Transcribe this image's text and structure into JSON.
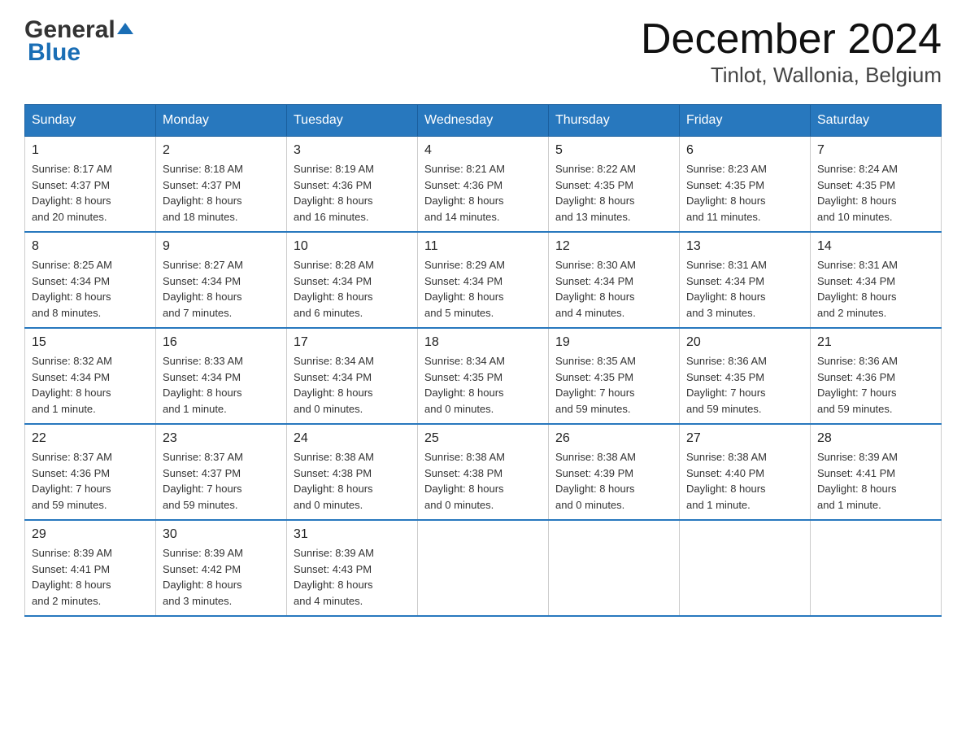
{
  "header": {
    "logo_general": "General",
    "logo_blue": "Blue",
    "month_title": "December 2024",
    "location": "Tinlot, Wallonia, Belgium"
  },
  "weekdays": [
    "Sunday",
    "Monday",
    "Tuesday",
    "Wednesday",
    "Thursday",
    "Friday",
    "Saturday"
  ],
  "weeks": [
    [
      {
        "day": "1",
        "sunrise": "8:17 AM",
        "sunset": "4:37 PM",
        "daylight": "8 hours and 20 minutes."
      },
      {
        "day": "2",
        "sunrise": "8:18 AM",
        "sunset": "4:37 PM",
        "daylight": "8 hours and 18 minutes."
      },
      {
        "day": "3",
        "sunrise": "8:19 AM",
        "sunset": "4:36 PM",
        "daylight": "8 hours and 16 minutes."
      },
      {
        "day": "4",
        "sunrise": "8:21 AM",
        "sunset": "4:36 PM",
        "daylight": "8 hours and 14 minutes."
      },
      {
        "day": "5",
        "sunrise": "8:22 AM",
        "sunset": "4:35 PM",
        "daylight": "8 hours and 13 minutes."
      },
      {
        "day": "6",
        "sunrise": "8:23 AM",
        "sunset": "4:35 PM",
        "daylight": "8 hours and 11 minutes."
      },
      {
        "day": "7",
        "sunrise": "8:24 AM",
        "sunset": "4:35 PM",
        "daylight": "8 hours and 10 minutes."
      }
    ],
    [
      {
        "day": "8",
        "sunrise": "8:25 AM",
        "sunset": "4:34 PM",
        "daylight": "8 hours and 8 minutes."
      },
      {
        "day": "9",
        "sunrise": "8:27 AM",
        "sunset": "4:34 PM",
        "daylight": "8 hours and 7 minutes."
      },
      {
        "day": "10",
        "sunrise": "8:28 AM",
        "sunset": "4:34 PM",
        "daylight": "8 hours and 6 minutes."
      },
      {
        "day": "11",
        "sunrise": "8:29 AM",
        "sunset": "4:34 PM",
        "daylight": "8 hours and 5 minutes."
      },
      {
        "day": "12",
        "sunrise": "8:30 AM",
        "sunset": "4:34 PM",
        "daylight": "8 hours and 4 minutes."
      },
      {
        "day": "13",
        "sunrise": "8:31 AM",
        "sunset": "4:34 PM",
        "daylight": "8 hours and 3 minutes."
      },
      {
        "day": "14",
        "sunrise": "8:31 AM",
        "sunset": "4:34 PM",
        "daylight": "8 hours and 2 minutes."
      }
    ],
    [
      {
        "day": "15",
        "sunrise": "8:32 AM",
        "sunset": "4:34 PM",
        "daylight": "8 hours and 1 minute."
      },
      {
        "day": "16",
        "sunrise": "8:33 AM",
        "sunset": "4:34 PM",
        "daylight": "8 hours and 1 minute."
      },
      {
        "day": "17",
        "sunrise": "8:34 AM",
        "sunset": "4:34 PM",
        "daylight": "8 hours and 0 minutes."
      },
      {
        "day": "18",
        "sunrise": "8:34 AM",
        "sunset": "4:35 PM",
        "daylight": "8 hours and 0 minutes."
      },
      {
        "day": "19",
        "sunrise": "8:35 AM",
        "sunset": "4:35 PM",
        "daylight": "7 hours and 59 minutes."
      },
      {
        "day": "20",
        "sunrise": "8:36 AM",
        "sunset": "4:35 PM",
        "daylight": "7 hours and 59 minutes."
      },
      {
        "day": "21",
        "sunrise": "8:36 AM",
        "sunset": "4:36 PM",
        "daylight": "7 hours and 59 minutes."
      }
    ],
    [
      {
        "day": "22",
        "sunrise": "8:37 AM",
        "sunset": "4:36 PM",
        "daylight": "7 hours and 59 minutes."
      },
      {
        "day": "23",
        "sunrise": "8:37 AM",
        "sunset": "4:37 PM",
        "daylight": "7 hours and 59 minutes."
      },
      {
        "day": "24",
        "sunrise": "8:38 AM",
        "sunset": "4:38 PM",
        "daylight": "8 hours and 0 minutes."
      },
      {
        "day": "25",
        "sunrise": "8:38 AM",
        "sunset": "4:38 PM",
        "daylight": "8 hours and 0 minutes."
      },
      {
        "day": "26",
        "sunrise": "8:38 AM",
        "sunset": "4:39 PM",
        "daylight": "8 hours and 0 minutes."
      },
      {
        "day": "27",
        "sunrise": "8:38 AM",
        "sunset": "4:40 PM",
        "daylight": "8 hours and 1 minute."
      },
      {
        "day": "28",
        "sunrise": "8:39 AM",
        "sunset": "4:41 PM",
        "daylight": "8 hours and 1 minute."
      }
    ],
    [
      {
        "day": "29",
        "sunrise": "8:39 AM",
        "sunset": "4:41 PM",
        "daylight": "8 hours and 2 minutes."
      },
      {
        "day": "30",
        "sunrise": "8:39 AM",
        "sunset": "4:42 PM",
        "daylight": "8 hours and 3 minutes."
      },
      {
        "day": "31",
        "sunrise": "8:39 AM",
        "sunset": "4:43 PM",
        "daylight": "8 hours and 4 minutes."
      },
      null,
      null,
      null,
      null
    ]
  ]
}
